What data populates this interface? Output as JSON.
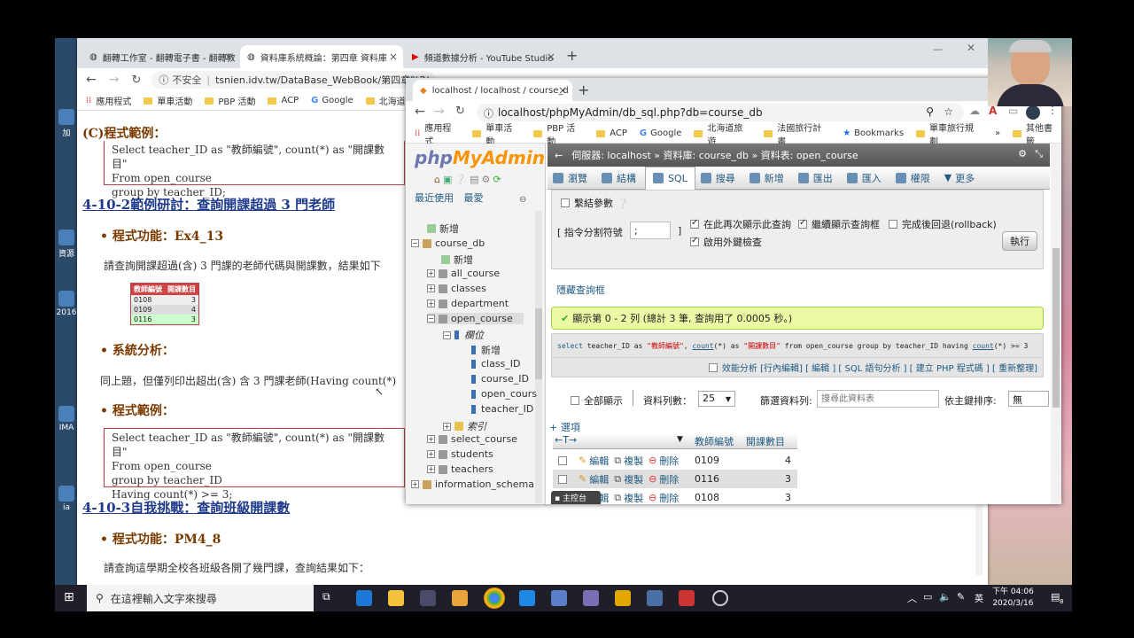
{
  "desktop": {
    "icons": [
      "加",
      "資源",
      "2016",
      "IMA",
      "ia"
    ]
  },
  "back_browser": {
    "tabs": [
      {
        "label": "翻轉工作室 - 翻轉電子書 - 翻轉教"
      },
      {
        "label": "資料庫系統概論：第四章 資料庫"
      },
      {
        "label": "頻道數據分析 - YouTube Studio"
      }
    ],
    "new_tab": "+",
    "close": "×",
    "security": "不安全",
    "url": "tsnien.idv.tw/DataBase_WebBook/第四章%2(",
    "bookmarks": [
      "應用程式",
      "單車活動",
      "PBP 活動",
      "ACP",
      "Google",
      "北海道"
    ],
    "window_controls": [
      "—",
      "☐",
      "✕"
    ]
  },
  "document": {
    "c_heading": "(C)程式範例：",
    "code1": [
      "Select  teacher_ID  as \"教師編號\", count(*) as \"開課數目\"",
      "From open_course",
      "group by teacher_ID;"
    ],
    "section_4_10_2": "4-10-2範例研討：查詢開課超過 3 門老師",
    "func_label": "程式功能：Ex4_13",
    "func_desc": "請查詢開課超過(含) 3 門課的老師代碼與開課數，結果如下",
    "mini_table": {
      "headers": [
        "教師編號",
        "開課數目"
      ],
      "rows": [
        [
          "0108",
          "3"
        ],
        [
          "0109",
          "4"
        ],
        [
          "0116",
          "3"
        ]
      ]
    },
    "analysis_label": "系統分析：",
    "analysis_desc": "同上題，但僅列印出超出(含) 含 3 門課老師(Having count(*)",
    "example_label": "程式範例：",
    "code2": [
      "Select  teacher_ID  as \"教師編號\", count(*) as \"開課數目\"",
      "From open_course",
      "group by teacher_ID",
      "Having count(*) >= 3;"
    ],
    "section_4_10_3": "4-10-3自我挑戰：查詢班級開課數",
    "func_label2": "程式功能：PM4_8",
    "func_desc2": "請查詢這學期全校各班級各開了幾門課，查詢結果如下："
  },
  "front_browser": {
    "tab_label": "localhost / localhost / course_d",
    "url": "localhost/phpMyAdmin/db_sql.php?db=course_db",
    "bookmarks": [
      "應用程式",
      "單車活動",
      "PBP 活動",
      "ACP",
      "Google",
      "北海道旅遊",
      "法國旅行計畫",
      "Bookmarks",
      "單車旅行規劃",
      "»",
      "其他書籤"
    ],
    "pma": {
      "logo_a": "php",
      "logo_b": "MyAdmin",
      "recent": "最近使用",
      "fav": "最愛",
      "tree": [
        {
          "label": "新增",
          "level": 1
        },
        {
          "label": "course_db",
          "level": 0
        },
        {
          "label": "新增",
          "level": 1
        },
        {
          "label": "all_course",
          "level": 1
        },
        {
          "label": "classes",
          "level": 1
        },
        {
          "label": "department",
          "level": 1
        },
        {
          "label": "open_course",
          "level": 1
        },
        {
          "label": "欄位",
          "level": 2
        },
        {
          "label": "新增",
          "level": 3
        },
        {
          "label": "class_ID",
          "level": 3
        },
        {
          "label": "course_ID",
          "level": 3
        },
        {
          "label": "open_cours",
          "level": 3
        },
        {
          "label": "teacher_ID",
          "level": 3
        },
        {
          "label": "索引",
          "level": 2
        },
        {
          "label": "select_course",
          "level": 1
        },
        {
          "label": "students",
          "level": 1
        },
        {
          "label": "teachers",
          "level": 1
        },
        {
          "label": "information_schema",
          "level": 0
        }
      ],
      "breadcrumb": "伺服器: localhost » 資料庫: course_db » 資料表: open_course",
      "tabs": [
        "瀏覽",
        "結構",
        "SQL",
        "搜尋",
        "新增",
        "匯出",
        "匯入",
        "權限",
        "更多"
      ],
      "bind_params": "繫結參數",
      "delimiter_label": "[ 指令分割符號",
      "delimiter_value": ";",
      "delimiter_close": "]",
      "opt1": "在此再次顯示此查詢",
      "opt2": "繼續顯示查詢框",
      "opt3": "完成後回退(rollback)",
      "opt4": "啟用外鍵檢查",
      "exec": "執行",
      "hide_query": "隱藏查詢框",
      "success": "顯示第 0 - 2 列 (總計 3 筆, 查詢用了 0.0005 秒。)",
      "sql": {
        "p1": "select",
        "p2": " teacher_ID as ",
        "p3": "\"教師編號\"",
        "p4": ", ",
        "p5": "count",
        "p6": "(*) as ",
        "p7": "\"開課數目\"",
        "p8": " from open_course group by teacher_ID having ",
        "p9": "count",
        "p10": "(*) >= 3"
      },
      "links": "效能分析 [行內編輯] [ 編輯 ] [ SQL 語句分析 ] [ 建立 PHP 程式碼 ] [ 重新整理]",
      "show_all": "全部顯示",
      "rows_label": "資料列數：",
      "rows_value": "25",
      "filter_label": "篩選資料列:",
      "filter_placeholder": "搜尋此資料表",
      "sort_label": "依主鍵排序:",
      "sort_value": "無",
      "options": "+ 選項",
      "col1": "教師編號",
      "col2": "開課數目",
      "edit": "編輯",
      "copy": "複製",
      "del": "刪除",
      "rows": [
        [
          "0109",
          "4"
        ],
        [
          "0116",
          "3"
        ],
        [
          "0108",
          "3"
        ]
      ],
      "console": "主控台"
    }
  },
  "taskbar": {
    "search_placeholder": "在這裡輸入文字來搜尋",
    "time": "下午 04:06",
    "date": "2020/3/16",
    "ime": "英",
    "notif": "8"
  },
  "colors": {
    "pma_accent": "#235a81",
    "success_bg": "#ebf8a4",
    "heading": "#7a3a00",
    "section": "#1f3a8a"
  }
}
